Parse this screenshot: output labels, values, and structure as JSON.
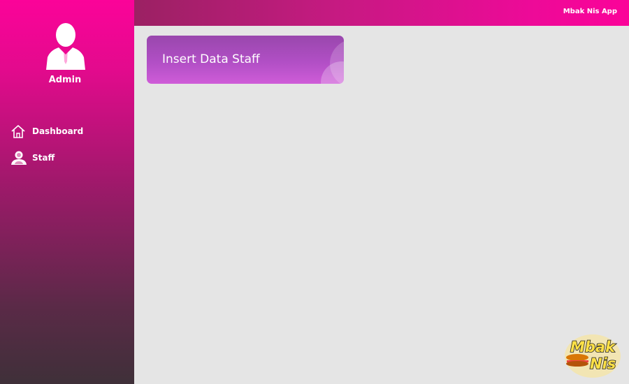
{
  "sidebar": {
    "user_label": "Admin",
    "items": [
      {
        "label": "Dashboard",
        "icon": "home-icon"
      },
      {
        "label": "Staff",
        "icon": "users-icon"
      }
    ]
  },
  "header": {
    "app_title": "Mbak Nis App"
  },
  "main": {
    "card_title": "Insert Data Staff"
  },
  "logo": {
    "text_line1": "Mbak",
    "text_line2": "Nis",
    "icon": "burger-logo-icon"
  },
  "colors": {
    "brand_pink": "#fb0399",
    "sidebar_bottom": "#3f3039",
    "card_purple": "#b14fc5",
    "content_bg": "#e5e5e5"
  }
}
